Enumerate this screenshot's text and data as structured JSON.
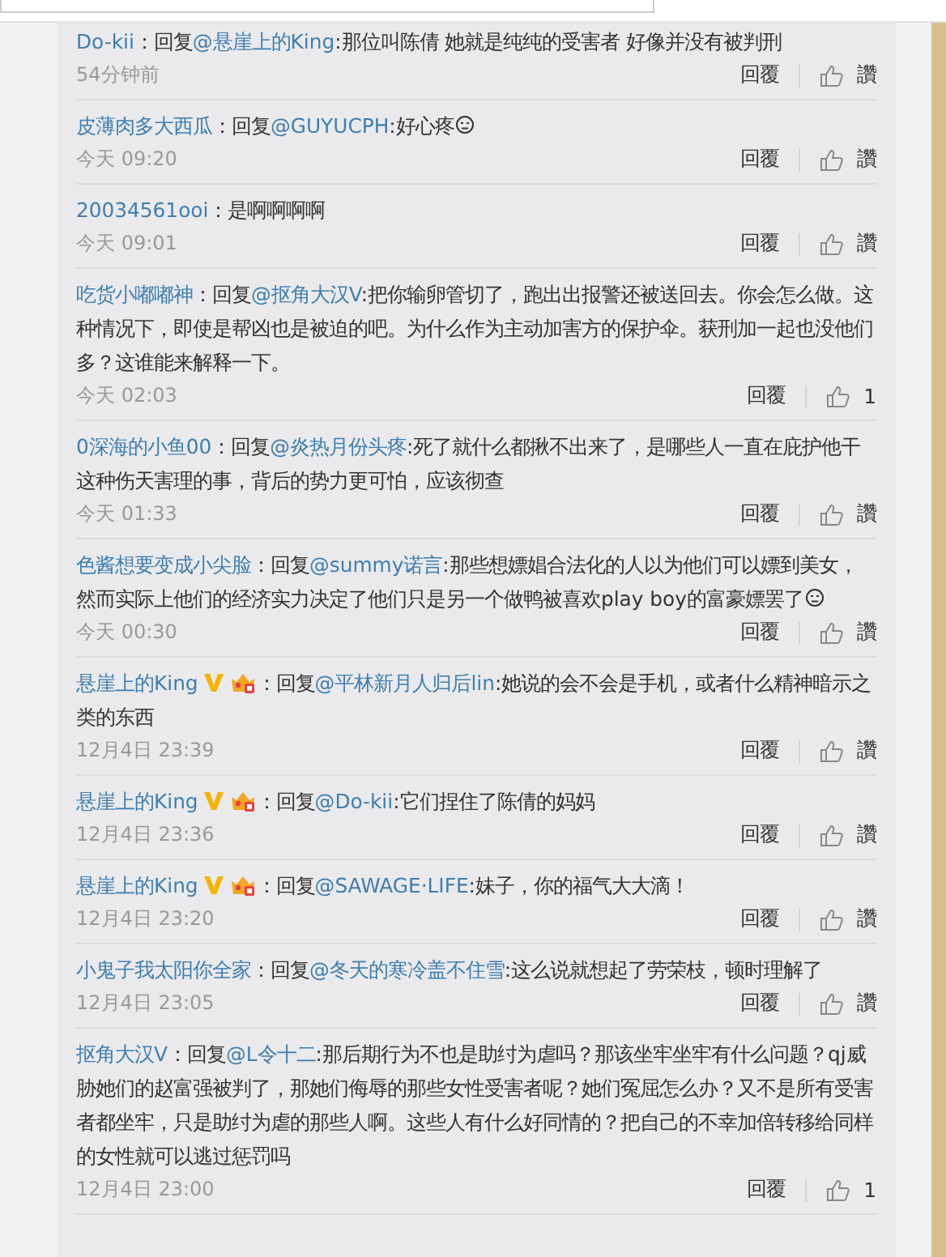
{
  "comments": [
    {
      "user": "Do-kii",
      "verified": false,
      "vip": false,
      "prefix": "：回复",
      "mention": "@悬崖上的King",
      "text": ":那位叫陈倩 她就是纯纯的受害者 好像并没有被判刑",
      "emoji": false,
      "time": "54分钟前",
      "reply_label": "回覆",
      "like_label": "讚"
    },
    {
      "user": "皮薄肉多大西瓜",
      "verified": false,
      "vip": false,
      "prefix": "：回复",
      "mention": "@GUYUCPH",
      "text": ":好心疼",
      "emoji": true,
      "time": "今天 09:20",
      "reply_label": "回覆",
      "like_label": "讚"
    },
    {
      "user": "20034561ooi",
      "verified": false,
      "vip": false,
      "prefix": "：",
      "text": "是啊啊啊啊",
      "emoji": false,
      "time": "今天 09:01",
      "reply_label": "回覆",
      "like_label": "讚"
    },
    {
      "user": "吃货小嘟嘟神",
      "verified": false,
      "vip": false,
      "prefix": "：回复",
      "mention": "@抠角大汉V",
      "text": ":把你输卵管切了，跑出出报警还被送回去。你会怎么做。这种情况下，即使是帮凶也是被迫的吧。为什么作为主动加害方的保护伞。获刑加一起也没他们多？这谁能来解释一下。",
      "emoji": false,
      "time": "今天 02:03",
      "reply_label": "回覆",
      "like_label": "1"
    },
    {
      "user": "0深海的小鱼00",
      "verified": false,
      "vip": false,
      "prefix": "：回复",
      "mention": "@炎热月份头疼",
      "text": ":死了就什么都揪不出来了，是哪些人一直在庇护他干这种伤天害理的事，背后的势力更可怕，应该彻查",
      "emoji": false,
      "time": "今天 01:33",
      "reply_label": "回覆",
      "like_label": "讚"
    },
    {
      "user": "色酱想要变成小尖脸",
      "verified": false,
      "vip": false,
      "prefix": "：回复",
      "mention": "@summy诺言",
      "text": ":那些想嫖娼合法化的人以为他们可以嫖到美女，然而实际上他们的经济实力决定了他们只是另一个做鸭被喜欢play boy的富豪嫖罢了",
      "emoji": true,
      "time": "今天 00:30",
      "reply_label": "回覆",
      "like_label": "讚"
    },
    {
      "user": "悬崖上的King",
      "verified": true,
      "vip": true,
      "prefix": "：回复",
      "mention": "@平林新月人归后lin",
      "text": ":她说的会不会是手机，或者什么精神暗示之类的东西",
      "emoji": false,
      "time": "12月4日 23:39",
      "reply_label": "回覆",
      "like_label": "讚"
    },
    {
      "user": "悬崖上的King",
      "verified": true,
      "vip": true,
      "prefix": "：回复",
      "mention": "@Do-kii",
      "text": ":它们捏住了陈倩的妈妈",
      "emoji": false,
      "time": "12月4日 23:36",
      "reply_label": "回覆",
      "like_label": "讚"
    },
    {
      "user": "悬崖上的King",
      "verified": true,
      "vip": true,
      "prefix": "：回复",
      "mention": "@SAWAGE·LIFE",
      "text": ":妹子，你的福气大大滴！",
      "emoji": false,
      "time": "12月4日 23:20",
      "reply_label": "回覆",
      "like_label": "讚"
    },
    {
      "user": "小鬼子我太阳你全家",
      "verified": false,
      "vip": false,
      "prefix": "：回复",
      "mention": "@冬天的寒冷盖不住雪",
      "text": ":这么说就想起了劳荣枝，顿时理解了",
      "emoji": false,
      "time": "12月4日 23:05",
      "reply_label": "回覆",
      "like_label": "讚"
    },
    {
      "user": "抠角大汉V",
      "verified": false,
      "vip": false,
      "prefix": "：回复",
      "mention": "@L令十二",
      "text": ":那后期行为不也是助纣为虐吗？那该坐牢坐牢有什么问题？qj威胁她们的赵富强被判了，那她们侮辱的那些女性受害者呢？她们冤屈怎么办？又不是所有受害者都坐牢，只是助纣为虐的那些人啊。这些人有什么好同情的？把自己的不幸加倍转移给同样的女性就可以逃过惩罚吗",
      "emoji": false,
      "time": "12月4日 23:00",
      "reply_label": "回覆",
      "like_label": "1"
    }
  ]
}
